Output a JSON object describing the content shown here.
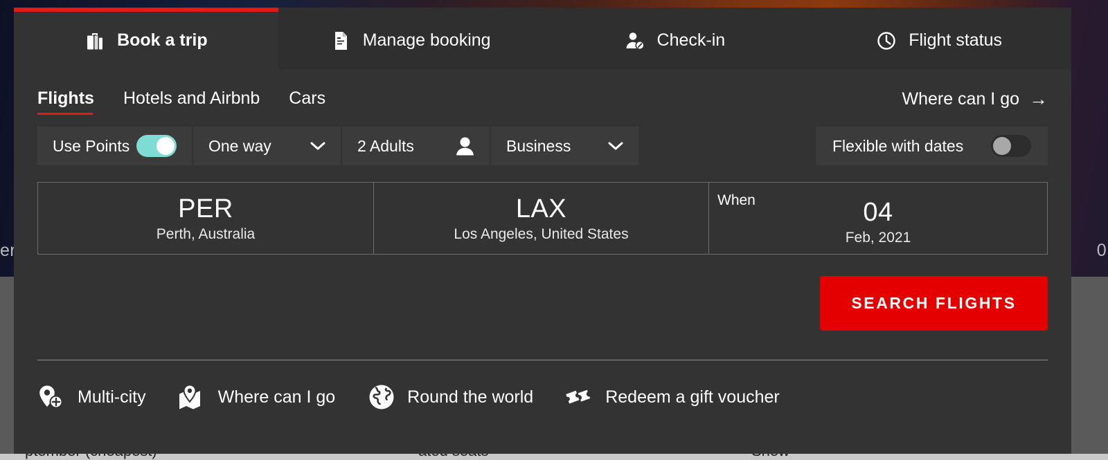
{
  "background": {
    "left_text_fragment": "er",
    "right_text_fragment": "0",
    "bottom_peek": [
      "ptember (cheapest)",
      "ated seats",
      "Show"
    ]
  },
  "tabs": [
    {
      "label": "Book a trip",
      "icon": "suitcase-icon",
      "active": true
    },
    {
      "label": "Manage booking",
      "icon": "document-icon",
      "active": false
    },
    {
      "label": "Check-in",
      "icon": "person-check-icon",
      "active": false
    },
    {
      "label": "Flight status",
      "icon": "clock-icon",
      "active": false
    }
  ],
  "subnav": {
    "items": [
      {
        "label": "Flights",
        "active": true
      },
      {
        "label": "Hotels and Airbnb",
        "active": false
      },
      {
        "label": "Cars",
        "active": false
      }
    ],
    "where_can_i_go": {
      "label": "Where can I go",
      "icon": "arrow-right-icon"
    }
  },
  "options": {
    "use_points": {
      "label": "Use Points",
      "state": "on"
    },
    "trip_type": {
      "value": "One way",
      "icon": "chevron-down-icon"
    },
    "passengers": {
      "value": "2 Adults",
      "icon": "person-icon"
    },
    "cabin_class": {
      "value": "Business",
      "icon": "chevron-down-icon"
    },
    "flexible_dates": {
      "label": "Flexible with dates",
      "state": "off"
    }
  },
  "route": {
    "origin": {
      "code": "PER",
      "place": "Perth, Australia"
    },
    "destination": {
      "code": "LAX",
      "place": "Los Angeles, United States"
    },
    "when": {
      "label": "When",
      "day": "04",
      "month_year": "Feb, 2021"
    }
  },
  "search_button": {
    "label": "SEARCH FLIGHTS",
    "color": "#e50000"
  },
  "quick_links": [
    {
      "label": "Multi-city",
      "icon": "pin-plus-icon"
    },
    {
      "label": "Where can I go",
      "icon": "map-pin-icon"
    },
    {
      "label": "Round the world",
      "icon": "globe-icon"
    },
    {
      "label": "Redeem a gift voucher",
      "icon": "tickets-icon"
    }
  ],
  "colors": {
    "accent_red": "#e41a17",
    "toggle_on": "#7fdcd5",
    "panel": "#333333",
    "field": "#3b3b3b"
  }
}
